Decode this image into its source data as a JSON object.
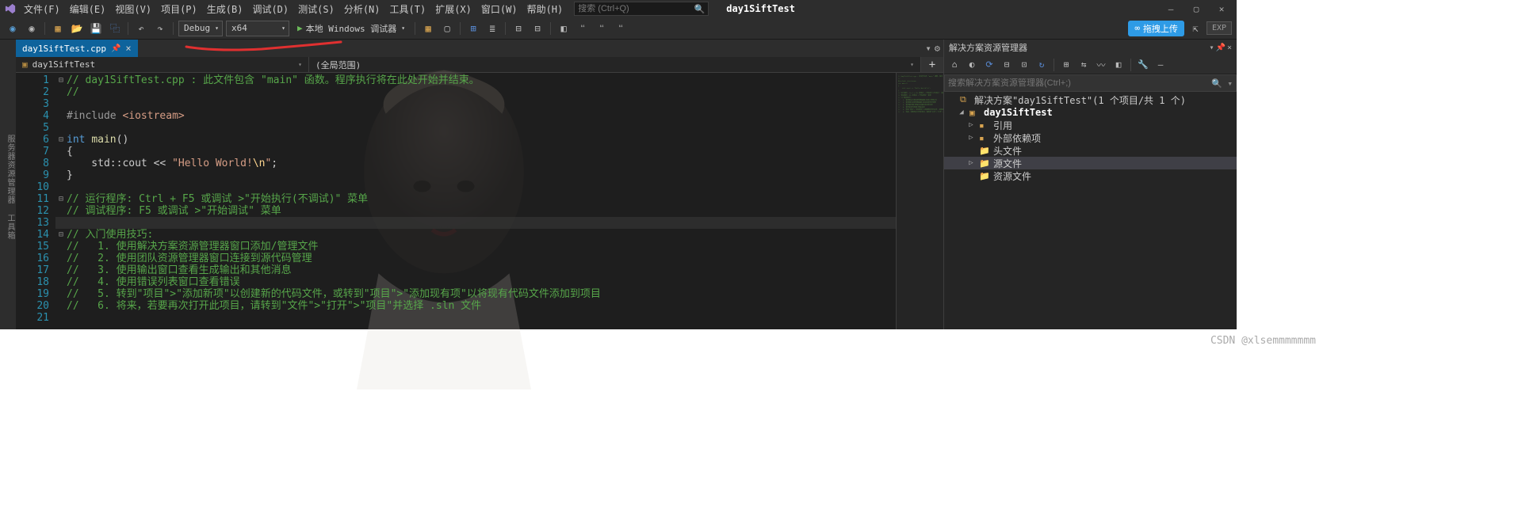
{
  "menus": [
    "文件(F)",
    "编辑(E)",
    "视图(V)",
    "项目(P)",
    "生成(B)",
    "调试(D)",
    "测试(S)",
    "分析(N)",
    "工具(T)",
    "扩展(X)",
    "窗口(W)",
    "帮助(H)"
  ],
  "search": {
    "placeholder": "搜索 (Ctrl+Q)"
  },
  "title": "day1SiftTest",
  "toolbar": {
    "config": "Debug",
    "platform": "x64",
    "debugger": "本地 Windows 调试器",
    "upload": "拖拽上传",
    "exp": "EXP"
  },
  "left_sidebar": "服务器资源管理器  工具箱",
  "tab": {
    "name": "day1SiftTest.cpp"
  },
  "nav": {
    "project": "day1SiftTest",
    "scope": "(全局范围)"
  },
  "code": {
    "lines": [
      {
        "n": 1,
        "fold": "⊟",
        "seg": [
          {
            "c": "c-comment",
            "t": "// day1SiftTest.cpp : 此文件包含 \"main\" 函数。程序执行将在此处开始并结束。"
          }
        ]
      },
      {
        "n": 2,
        "seg": [
          {
            "c": "c-comment",
            "t": "//"
          }
        ]
      },
      {
        "n": 3,
        "seg": []
      },
      {
        "n": 4,
        "seg": [
          {
            "c": "c-pre",
            "t": "#include "
          },
          {
            "c": "c-string",
            "t": "<iostream>"
          }
        ]
      },
      {
        "n": 5,
        "seg": []
      },
      {
        "n": 6,
        "fold": "⊟",
        "seg": [
          {
            "c": "c-type",
            "t": "int"
          },
          {
            "c": "",
            "t": " "
          },
          {
            "c": "c-func",
            "t": "main"
          },
          {
            "c": "c-punc",
            "t": "()"
          }
        ]
      },
      {
        "n": 7,
        "seg": [
          {
            "c": "c-punc",
            "t": "{"
          }
        ]
      },
      {
        "n": 8,
        "seg": [
          {
            "c": "",
            "t": "    std::cout << "
          },
          {
            "c": "c-string",
            "t": "\"Hello World!"
          },
          {
            "c": "c-esc",
            "t": "\\n"
          },
          {
            "c": "c-string",
            "t": "\""
          },
          {
            "c": "c-punc",
            "t": ";"
          }
        ]
      },
      {
        "n": 9,
        "seg": [
          {
            "c": "c-punc",
            "t": "}"
          }
        ]
      },
      {
        "n": 10,
        "seg": []
      },
      {
        "n": 11,
        "fold": "⊟",
        "seg": [
          {
            "c": "c-comment",
            "t": "// 运行程序: Ctrl + F5 或调试 >\"开始执行(不调试)\" 菜单"
          }
        ]
      },
      {
        "n": 12,
        "seg": [
          {
            "c": "c-comment",
            "t": "// 调试程序: F5 或调试 >\"开始调试\" 菜单"
          }
        ]
      },
      {
        "n": 13,
        "hl": true,
        "seg": []
      },
      {
        "n": 14,
        "fold": "⊟",
        "seg": [
          {
            "c": "c-comment",
            "t": "// 入门使用技巧:"
          }
        ]
      },
      {
        "n": 15,
        "seg": [
          {
            "c": "c-comment",
            "t": "//   1. 使用解决方案资源管理器窗口添加/管理文件"
          }
        ]
      },
      {
        "n": 16,
        "seg": [
          {
            "c": "c-comment",
            "t": "//   2. 使用团队资源管理器窗口连接到源代码管理"
          }
        ]
      },
      {
        "n": 17,
        "seg": [
          {
            "c": "c-comment",
            "t": "//   3. 使用输出窗口查看生成输出和其他消息"
          }
        ]
      },
      {
        "n": 18,
        "seg": [
          {
            "c": "c-comment",
            "t": "//   4. 使用错误列表窗口查看错误"
          }
        ]
      },
      {
        "n": 19,
        "seg": [
          {
            "c": "c-comment",
            "t": "//   5. 转到\"项目\">\"添加新项\"以创建新的代码文件，或转到\"项目\">\"添加现有项\"以将现有代码文件添加到项目"
          }
        ]
      },
      {
        "n": 20,
        "seg": [
          {
            "c": "c-comment",
            "t": "//   6. 将来，若要再次打开此项目，请转到\"文件\">\"打开\">\"项目\"并选择 .sln 文件"
          }
        ]
      },
      {
        "n": 21,
        "seg": []
      }
    ]
  },
  "solution_panel": {
    "title": "解决方案资源管理器",
    "search_placeholder": "搜索解决方案资源管理器(Ctrl+;)",
    "tree": [
      {
        "ind": 0,
        "exp": "",
        "ico": "⧉",
        "label": "解决方案\"day1SiftTest\"(1 个项目/共 1 个)"
      },
      {
        "ind": 1,
        "exp": "◢",
        "ico": "▣",
        "label": "day1SiftTest",
        "bold": true
      },
      {
        "ind": 2,
        "exp": "▷",
        "ico": "▪",
        "label": "引用"
      },
      {
        "ind": 2,
        "exp": "▷",
        "ico": "▪",
        "label": "外部依赖项"
      },
      {
        "ind": 2,
        "exp": "",
        "ico": "📁",
        "label": "头文件"
      },
      {
        "ind": 2,
        "exp": "▷",
        "ico": "📁",
        "label": "源文件",
        "sel": true
      },
      {
        "ind": 2,
        "exp": "",
        "ico": "📁",
        "label": "资源文件"
      }
    ]
  },
  "watermark": "CSDN @xlsemmmmmmm"
}
